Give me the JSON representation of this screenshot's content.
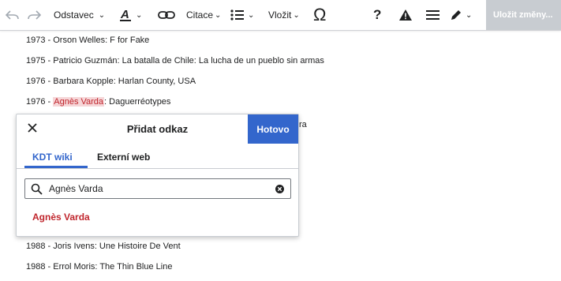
{
  "toolbar": {
    "undo_icon": "undo-icon",
    "redo_icon": "redo-icon",
    "format_label": "Odstavec",
    "text_style_icon": "text-style-icon",
    "link_icon": "link-icon",
    "cite_label": "Citace",
    "list_icon": "bullet-list-icon",
    "insert_label": "Vložit",
    "special_char": "Ω",
    "help_label": "?",
    "notice_icon": "alert-icon",
    "menu_icon": "hamburger-menu-icon",
    "edit_icon": "pencil-icon",
    "save_label": "Uložit změny..."
  },
  "content": {
    "lines": [
      "1973 - Orson Welles: F for Fake",
      "1975 - Patricio Guzmán: La batalla de Chile: La lucha de un pueblo sin armas",
      "1976 - Barbara Kopple: Harlan County, USA",
      "1988 - Joris Ivens: Une Histoire De Vent",
      "1988 - Errol Moris: The Thin Blue Line"
    ],
    "varda_prefix": "1976 - ",
    "varda_highlight": "Agnès Varda",
    "varda_suffix": ": Daguerréotypes",
    "truncated_text": "ra"
  },
  "dialog": {
    "title": "Přidat odkaz",
    "done_label": "Hotovo",
    "tabs": [
      "KDT wiki",
      "Externí web"
    ],
    "active_tab": "KDT wiki",
    "search_value": "Agnès Varda",
    "result": "Agnès Varda"
  },
  "colors": {
    "accent": "#3366cc",
    "link_red": "#c0262d",
    "highlight": "#f6d6d8",
    "disabled": "#c8ccd1"
  }
}
